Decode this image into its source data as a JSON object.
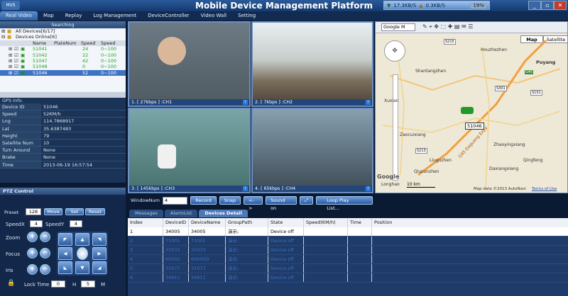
{
  "app": {
    "logo": "MVS",
    "title": "Mobile Device Management Platform",
    "net_down": "17.3KB/S",
    "net_up": "0.3KB/S",
    "cpu": "19%"
  },
  "menu": [
    "Real Video",
    "Map",
    "Replay",
    "Log Management",
    "DeviceController",
    "Video Wall",
    "Setting"
  ],
  "search": {
    "title": "Searching"
  },
  "tree": {
    "all_devices": "All Devices[6/17]",
    "online": "Devices Online[6]",
    "columns": [
      "Name",
      "PlateNum",
      "Speed",
      "Speed"
    ],
    "rows": [
      {
        "name": "51041",
        "speed": "24",
        "range": "0~100"
      },
      {
        "name": "51042",
        "speed": "22",
        "range": "0~100"
      },
      {
        "name": "51047",
        "speed": "42",
        "range": "0~100"
      },
      {
        "name": "51048",
        "speed": "0",
        "range": "0~100"
      },
      {
        "name": "51046",
        "speed": "52",
        "range": "0~100"
      }
    ]
  },
  "gps": {
    "title": "GPS Info.",
    "rows": [
      {
        "k": "Device ID",
        "v": "51046"
      },
      {
        "k": "Speed",
        "v": "52KM/h"
      },
      {
        "k": "Lng",
        "v": "114.7868917"
      },
      {
        "k": "Lat",
        "v": "35.6387483"
      },
      {
        "k": "Height",
        "v": "79"
      },
      {
        "k": "Satellite Num",
        "v": "10"
      },
      {
        "k": "Turn Around",
        "v": "None"
      },
      {
        "k": "Brake",
        "v": "None"
      },
      {
        "k": "Time",
        "v": "2013-06-19 16:57:54"
      }
    ]
  },
  "ptz": {
    "title": "PTZ Control",
    "preset_label": "Preset",
    "preset_value": "128",
    "move": "Move",
    "set": "Set",
    "reset": "Reset",
    "speedx_label": "SpeedX",
    "speedx": "4",
    "speedy_label": "SpeedY",
    "speedy": "4",
    "zoom": "Zoom",
    "focus": "Focus",
    "iris": "Iris",
    "lock_time": "Lock Time",
    "lock_h": "0",
    "h": "H",
    "lock_m": "5",
    "m": "M"
  },
  "videos": [
    {
      "label": "1. [ 27kbps ] :CH1"
    },
    {
      "label": "2. [ 7kbps ] :CH2"
    },
    {
      "label": "3. [ 145kbps ] :CH3"
    },
    {
      "label": "4. [ 65kbps ] :CH4"
    }
  ],
  "toolbar": {
    "window_num_label": "WindowNum",
    "window_num": "4",
    "record": "Record",
    "snap": "Snap",
    "swap": "<->",
    "sound": "Sound on",
    "loop": "Loop Play List..."
  },
  "map": {
    "provider": "Google M",
    "tab_map": "Map",
    "tab_satellite": "Satellite",
    "device_label": "51046",
    "scale_km": "10 km",
    "attribution": "Map data ©2013 AutoNavi",
    "terms": "Terms of Use",
    "google": "Google",
    "places": [
      "Houzhezhen",
      "Shantangzhen",
      "Puyang",
      "Xuxian",
      "Zaocuixiang",
      "Zhaoyingxiang",
      "Liuguzhen",
      "Qingfeng",
      "Daxiangxiang",
      "Qiucunzhen",
      "Longhao"
    ],
    "road_labels": [
      "S215",
      "S301",
      "G45",
      "S101",
      "S213",
      "G45 Daguang Expy"
    ]
  },
  "bottom_tabs": [
    "Messages",
    "AlarmList",
    "Devices Detail"
  ],
  "table": {
    "columns": [
      "Index",
      "DeviceID",
      "DeviceName",
      "GroupPath",
      "State",
      "Speed(KM/h)",
      "Time",
      "Position"
    ],
    "rows": [
      [
        "1",
        "34005",
        "34005",
        "演示;",
        "Device off",
        "",
        "",
        ""
      ],
      [
        "2",
        "71001",
        "71001",
        "演示;",
        "Device off",
        "",
        "",
        ""
      ],
      [
        "3",
        "33333",
        "33333",
        "演示;",
        "Device off",
        "",
        "",
        ""
      ],
      [
        "4",
        "60002",
        "60000D",
        "演示;",
        "Device off",
        "",
        "",
        ""
      ],
      [
        "5",
        "31077",
        "31077",
        "演示;",
        "Device off",
        "",
        "",
        ""
      ],
      [
        "6",
        "34811",
        "34811",
        "演示;",
        "Device off",
        "",
        "",
        ""
      ]
    ]
  }
}
